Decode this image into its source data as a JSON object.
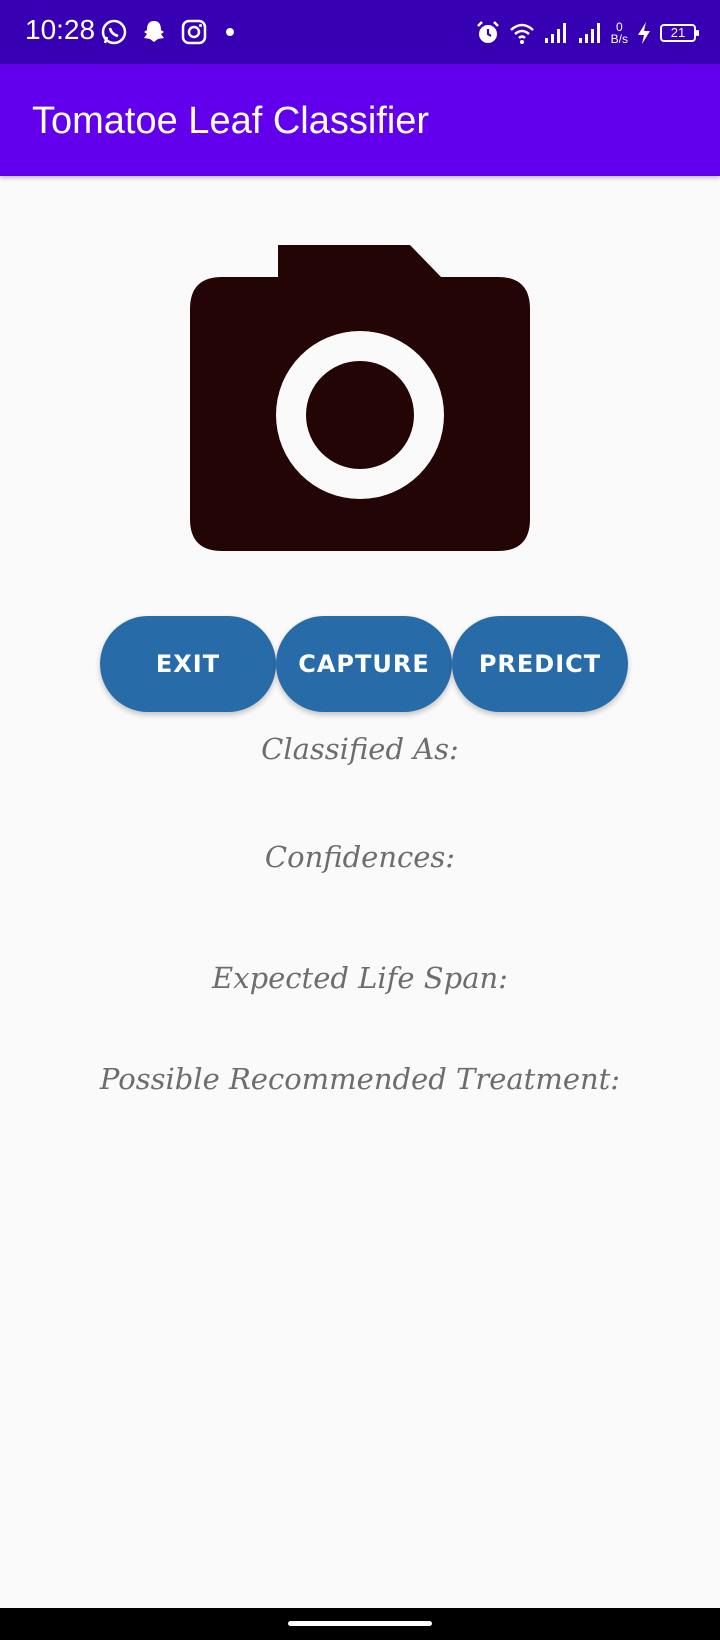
{
  "status_bar": {
    "time": "10:28",
    "net_speed_value": "0",
    "net_speed_unit": "B/s",
    "battery_level": "21",
    "icons_left": [
      "whatsapp-icon",
      "snapchat-icon",
      "instagram-icon",
      "dot-icon"
    ],
    "icons_right": [
      "alarm-icon",
      "wifi-icon",
      "signal-icon",
      "signal-icon",
      "charging-icon",
      "battery-icon"
    ]
  },
  "app_bar": {
    "title": "Tomatoe Leaf Classifier"
  },
  "preview": {
    "icon": "camera-icon",
    "color": "#230505"
  },
  "buttons": {
    "exit_label": "EXIT",
    "capture_label": "CAPTURE",
    "predict_label": "PREDICT",
    "color": "#276ca9"
  },
  "results": {
    "classified_label": "Classified As:",
    "confidences_label": "Confidences:",
    "life_span_label": "Expected Life Span:",
    "treatment_label": "Possible Recommended Treatment:"
  },
  "colors": {
    "status_bar": "#3700b3",
    "app_bar": "#6200ee",
    "background": "#fafafa"
  }
}
